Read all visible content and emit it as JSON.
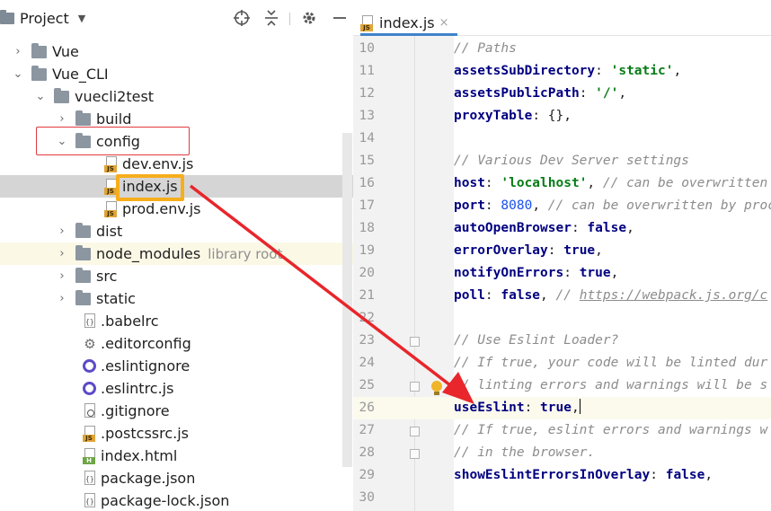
{
  "project_pane": {
    "title": "Project",
    "caret": "▼",
    "header_icons": [
      "crosshair-icon",
      "collapse-icon",
      "gear-icon",
      "minimize-icon"
    ]
  },
  "tree": {
    "items": [
      {
        "label": "Vue",
        "expanded": false
      },
      {
        "label": "Vue_CLI",
        "expanded": true
      },
      {
        "label": "vuecli2test",
        "expanded": true
      },
      {
        "label": "build",
        "expanded": false
      },
      {
        "label": "config",
        "expanded": true
      },
      {
        "label": "dev.env.js"
      },
      {
        "label": "index.js",
        "selected": true
      },
      {
        "label": "prod.env.js"
      },
      {
        "label": "dist",
        "expanded": false
      },
      {
        "label": "node_modules",
        "suffix": "library root",
        "expanded": false
      },
      {
        "label": "src",
        "expanded": false
      },
      {
        "label": "static",
        "expanded": false
      },
      {
        "label": ".babelrc"
      },
      {
        "label": ".editorconfig"
      },
      {
        "label": ".eslintignore"
      },
      {
        "label": ".eslintrc.js"
      },
      {
        "label": ".gitignore"
      },
      {
        "label": ".postcssrc.js"
      },
      {
        "label": "index.html"
      },
      {
        "label": "package.json"
      },
      {
        "label": "package-lock.json"
      }
    ]
  },
  "editor": {
    "tab": {
      "label": "index.js",
      "close": "×"
    },
    "file_badge_js": "JS",
    "file_badge_html": "H",
    "lines": [
      {
        "n": "10",
        "tokens": [
          {
            "t": "c",
            "v": "// Paths"
          }
        ]
      },
      {
        "n": "11",
        "tokens": [
          {
            "t": "k",
            "v": "assetsSubDirectory"
          },
          {
            "t": "p",
            "v": ": "
          },
          {
            "t": "s",
            "v": "'static'"
          },
          {
            "t": "p",
            "v": ","
          }
        ]
      },
      {
        "n": "12",
        "tokens": [
          {
            "t": "k",
            "v": "assetsPublicPath"
          },
          {
            "t": "p",
            "v": ": "
          },
          {
            "t": "s",
            "v": "'/'"
          },
          {
            "t": "p",
            "v": ","
          }
        ]
      },
      {
        "n": "13",
        "tokens": [
          {
            "t": "k",
            "v": "proxyTable"
          },
          {
            "t": "p",
            "v": ": {},"
          }
        ]
      },
      {
        "n": "14",
        "tokens": []
      },
      {
        "n": "15",
        "tokens": [
          {
            "t": "c",
            "v": "// Various Dev Server settings"
          }
        ]
      },
      {
        "n": "16",
        "tokens": [
          {
            "t": "k",
            "v": "host"
          },
          {
            "t": "p",
            "v": ": "
          },
          {
            "t": "s",
            "v": "'localhost'"
          },
          {
            "t": "p",
            "v": ", "
          },
          {
            "t": "c",
            "v": "// can be overwritten"
          }
        ]
      },
      {
        "n": "17",
        "tokens": [
          {
            "t": "k",
            "v": "port"
          },
          {
            "t": "p",
            "v": ": "
          },
          {
            "t": "n",
            "v": "8080"
          },
          {
            "t": "p",
            "v": ", "
          },
          {
            "t": "c",
            "v": "// can be overwritten by proc"
          }
        ]
      },
      {
        "n": "18",
        "tokens": [
          {
            "t": "k",
            "v": "autoOpenBrowser"
          },
          {
            "t": "p",
            "v": ": "
          },
          {
            "t": "b",
            "v": "false"
          },
          {
            "t": "p",
            "v": ","
          }
        ]
      },
      {
        "n": "19",
        "tokens": [
          {
            "t": "k",
            "v": "errorOverlay"
          },
          {
            "t": "p",
            "v": ": "
          },
          {
            "t": "b",
            "v": "true"
          },
          {
            "t": "p",
            "v": ","
          }
        ]
      },
      {
        "n": "20",
        "tokens": [
          {
            "t": "k",
            "v": "notifyOnErrors"
          },
          {
            "t": "p",
            "v": ": "
          },
          {
            "t": "b",
            "v": "true"
          },
          {
            "t": "p",
            "v": ","
          }
        ]
      },
      {
        "n": "21",
        "tokens": [
          {
            "t": "k",
            "v": "poll"
          },
          {
            "t": "p",
            "v": ": "
          },
          {
            "t": "b",
            "v": "false"
          },
          {
            "t": "p",
            "v": ", "
          },
          {
            "t": "c",
            "v": "// "
          },
          {
            "t": "u",
            "v": "https://webpack.js.org/c"
          }
        ]
      },
      {
        "n": "22",
        "tokens": []
      },
      {
        "n": "23",
        "tokens": [
          {
            "t": "c",
            "v": "// Use Eslint Loader?"
          }
        ]
      },
      {
        "n": "24",
        "tokens": [
          {
            "t": "c",
            "v": "// If true, your code will be linted dur"
          }
        ]
      },
      {
        "n": "25",
        "tokens": [
          {
            "t": "c",
            "v": "// linting errors and warnings will be s"
          }
        ]
      },
      {
        "n": "26",
        "current": true,
        "tokens": [
          {
            "t": "k",
            "v": "useEslint"
          },
          {
            "t": "p",
            "v": ": "
          },
          {
            "t": "b",
            "v": "true"
          },
          {
            "t": "p",
            "v": ","
          }
        ]
      },
      {
        "n": "27",
        "tokens": [
          {
            "t": "c",
            "v": "// If true, eslint errors and warnings w"
          }
        ]
      },
      {
        "n": "28",
        "tokens": [
          {
            "t": "c",
            "v": "// in the browser."
          }
        ]
      },
      {
        "n": "29",
        "tokens": [
          {
            "t": "k",
            "v": "showEslintErrorsInOverlay"
          },
          {
            "t": "p",
            "v": ": "
          },
          {
            "t": "b",
            "v": "false"
          },
          {
            "t": "p",
            "v": ","
          }
        ]
      },
      {
        "n": "30",
        "tokens": []
      }
    ]
  },
  "colors": {
    "selection": "#d5d5d5",
    "library_bg": "#fbf8e6",
    "annotation_red": "#e0393e",
    "annotation_yellow": "#f6ae1c",
    "current_line": "#fcfaed",
    "tab_underline": "#4083c9"
  }
}
